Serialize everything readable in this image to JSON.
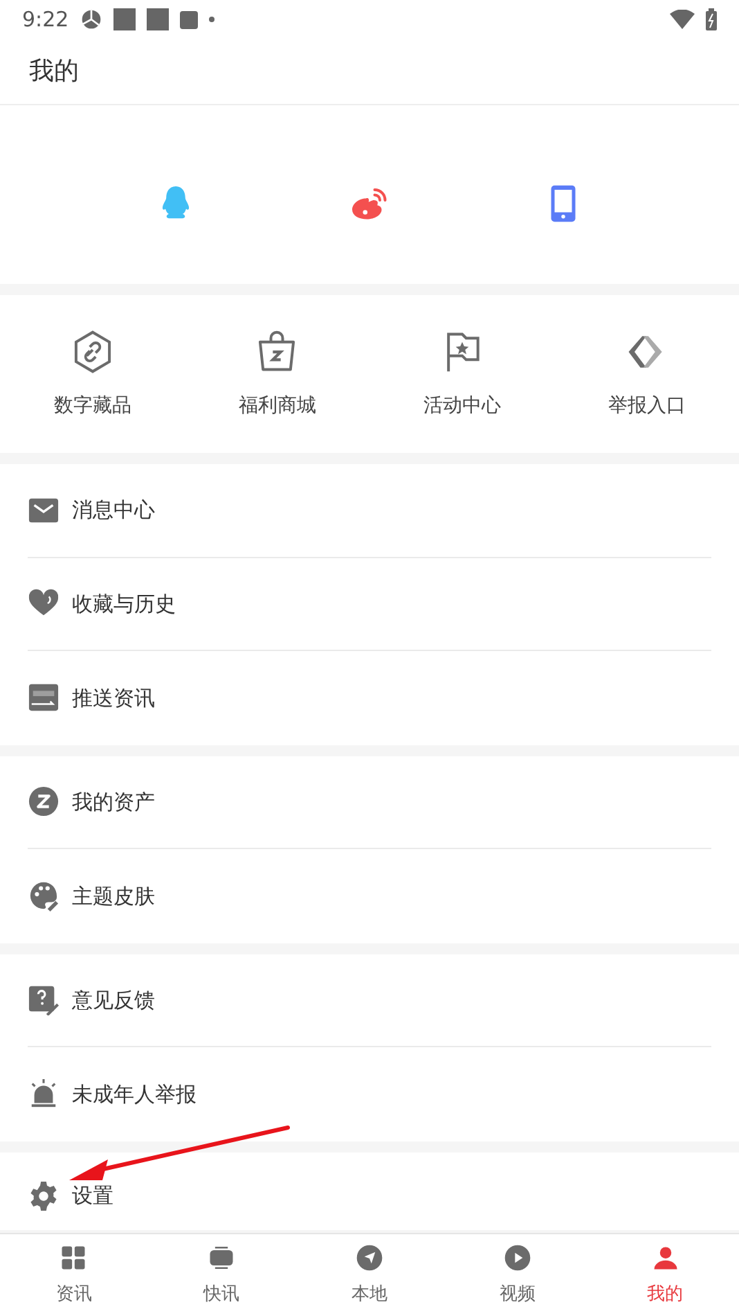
{
  "status_bar": {
    "time": "9:22"
  },
  "header": {
    "title": "我的"
  },
  "login_options": [
    {
      "kind": "qq"
    },
    {
      "kind": "weibo"
    },
    {
      "kind": "phone"
    }
  ],
  "shortcuts": [
    {
      "kind": "hex-link",
      "label": "数字藏品"
    },
    {
      "kind": "bag",
      "label": "福利商城"
    },
    {
      "kind": "flag",
      "label": "活动中心"
    },
    {
      "kind": "chevrons",
      "label": "举报入口"
    }
  ],
  "menu_groups": [
    {
      "items": [
        {
          "kind": "mail",
          "label": "消息中心"
        },
        {
          "kind": "heart",
          "label": "收藏与历史"
        },
        {
          "kind": "push",
          "label": "推送资讯"
        }
      ]
    },
    {
      "items": [
        {
          "kind": "coin",
          "label": "我的资产"
        },
        {
          "kind": "palette",
          "label": "主题皮肤"
        }
      ]
    },
    {
      "items": [
        {
          "kind": "feedback",
          "label": "意见反馈"
        },
        {
          "kind": "alarm",
          "label": "未成年人举报"
        }
      ]
    },
    {
      "items": [
        {
          "kind": "gear",
          "label": "设置"
        }
      ]
    }
  ],
  "annotation": {
    "kind": "arrow",
    "color": "#e8141b"
  },
  "bottom_nav": [
    {
      "kind": "grid",
      "label": "资讯",
      "selected": false
    },
    {
      "kind": "tv",
      "label": "快讯",
      "selected": false
    },
    {
      "kind": "compass",
      "label": "本地",
      "selected": false
    },
    {
      "kind": "play",
      "label": "视频",
      "selected": false
    },
    {
      "kind": "person",
      "label": "我的",
      "selected": true
    }
  ]
}
